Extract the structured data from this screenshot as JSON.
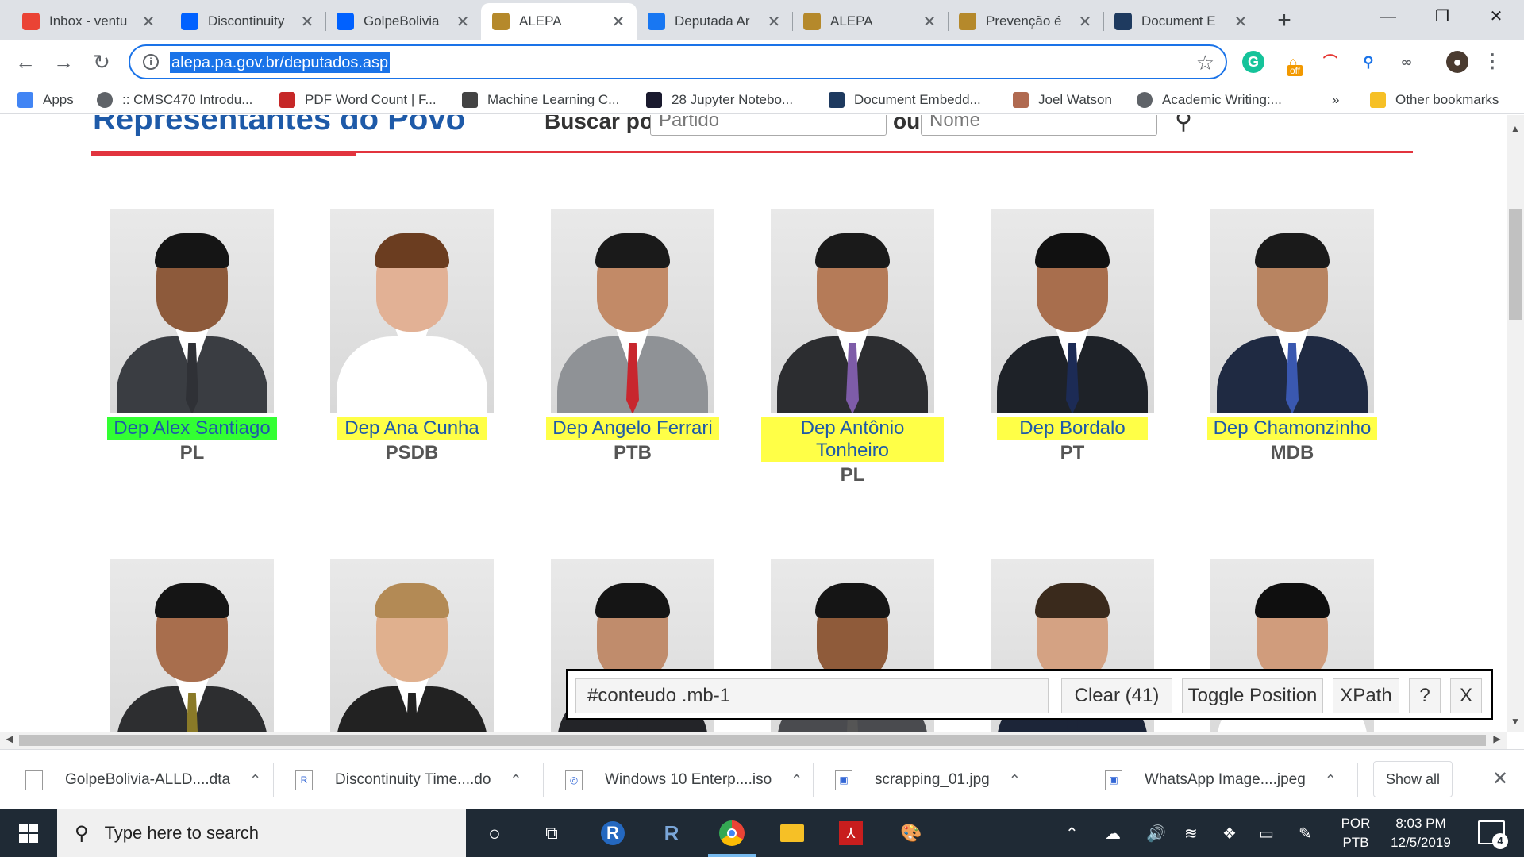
{
  "browser": {
    "tabs": [
      {
        "title": "Inbox - ventu",
        "icon": "gmail-icon",
        "color": "#ea4335"
      },
      {
        "title": "Discontinuity",
        "icon": "dropbox-icon",
        "color": "#0061ff"
      },
      {
        "title": "GolpeBolivia",
        "icon": "dropbox-icon",
        "color": "#0061ff"
      },
      {
        "title": "ALEPA",
        "icon": "alepa-seal-icon",
        "color": "#b5892b"
      },
      {
        "title": "Deputada Ar",
        "icon": "facebook-icon",
        "color": "#1877f2"
      },
      {
        "title": "ALEPA",
        "icon": "alepa-seal-icon",
        "color": "#b5892b"
      },
      {
        "title": "Prevenção é",
        "icon": "alepa-seal-icon",
        "color": "#b5892b"
      },
      {
        "title": "Document E",
        "icon": "document-icon",
        "color": "#1e3a5f"
      }
    ],
    "active_tab": 3,
    "url": "alepa.pa.gov.br/deputados.asp",
    "new_tab_glyph": "+",
    "close_glyph": "✕",
    "bookmarks": [
      {
        "label": "Apps",
        "icon": "apps-grid-icon"
      },
      {
        "label": ":: CMSC470 Introdu...",
        "icon": "globe-icon"
      },
      {
        "label": "PDF Word Count | F...",
        "icon": "pdf-icon"
      },
      {
        "label": "Machine Learning C...",
        "icon": "book-icon"
      },
      {
        "label": "28 Jupyter Notebo...",
        "icon": "jupyter-icon"
      },
      {
        "label": "Document Embedd...",
        "icon": "document-icon"
      },
      {
        "label": "Joel Watson",
        "icon": "photo-icon"
      },
      {
        "label": "Academic Writing:...",
        "icon": "globe-icon"
      }
    ],
    "bookmarks_overflow": "»",
    "other_bookmarks": "Other bookmarks",
    "extension_off_badge": "off"
  },
  "page": {
    "title": "Representantes do Povo",
    "search_label": "Buscar por:",
    "party_placeholder": "Partido",
    "or_label": "ou",
    "name_placeholder": "Nome",
    "deputies_row1": [
      {
        "name": "Dep Alex Santiago",
        "party": "PL",
        "skin": "#8d5a3b",
        "suit": "#3a3d42",
        "tie": "#2f3136",
        "hair": "#151515",
        "selected": true
      },
      {
        "name": "Dep Ana Cunha",
        "party": "PSDB",
        "skin": "#e2b195",
        "suit": "#ffffff",
        "tie": "#ffffff",
        "hair": "#6b3d20",
        "selected": false
      },
      {
        "name": "Dep Angelo Ferrari",
        "party": "PTB",
        "skin": "#c28a67",
        "suit": "#8f9296",
        "tie": "#c8262e",
        "hair": "#1a1a1a",
        "selected": false
      },
      {
        "name": "Dep Antônio Tonheiro",
        "party": "PL",
        "skin": "#b57b58",
        "suit": "#2c2d30",
        "tie": "#7e5ca8",
        "hair": "#1a1a1a",
        "selected": false
      },
      {
        "name": "Dep Bordalo",
        "party": "PT",
        "skin": "#a86e4d",
        "suit": "#1e2228",
        "tie": "#1c2b55",
        "hair": "#111111",
        "selected": false
      },
      {
        "name": "Dep Chamonzinho",
        "party": "MDB",
        "skin": "#b88461",
        "suit": "#1f2a42",
        "tie": "#3a58b0",
        "hair": "#1a1a1a",
        "selected": false
      }
    ],
    "deputies_row2": [
      {
        "skin": "#a86e4d",
        "suit": "#2d2e30",
        "tie": "#8a7a28",
        "hair": "#151515"
      },
      {
        "skin": "#e0b08e",
        "suit": "#222222",
        "tie": "#222222",
        "hair": "#b38a55"
      },
      {
        "skin": "#c08c6c",
        "suit": "#232428",
        "tie": "#232428",
        "hair": "#151515"
      },
      {
        "skin": "#8f5b3a",
        "suit": "#4a4b4f",
        "tie": "#555555",
        "hair": "#151515"
      },
      {
        "skin": "#d4a283",
        "suit": "#1c2538",
        "tie": "#1c2538",
        "hair": "#3a2a1c"
      },
      {
        "skin": "#d09c7c",
        "suit": "#ffffff",
        "tie": "#ffffff",
        "hair": "#0f0f0f"
      }
    ]
  },
  "selector_gadget": {
    "selector": "#conteudo .mb-1",
    "clear_label": "Clear (41)",
    "toggle_label": "Toggle Position",
    "xpath_label": "XPath",
    "help_label": "?",
    "close_label": "X"
  },
  "downloads": {
    "items": [
      {
        "name": "GolpeBolivia-ALLD....dta",
        "icon": "file-icon"
      },
      {
        "name": "Discontinuity Time....do",
        "icon": "r-file-icon"
      },
      {
        "name": "Windows 10 Enterp....iso",
        "icon": "iso-file-icon"
      },
      {
        "name": "scrapping_01.jpg",
        "icon": "image-file-icon"
      },
      {
        "name": "WhatsApp Image....jpeg",
        "icon": "image-file-icon"
      }
    ],
    "show_all": "Show all"
  },
  "taskbar": {
    "search_placeholder": "Type here to search",
    "language": [
      "POR",
      "PTB"
    ],
    "time": "8:03 PM",
    "date": "12/5/2019",
    "notification_count": "4"
  }
}
